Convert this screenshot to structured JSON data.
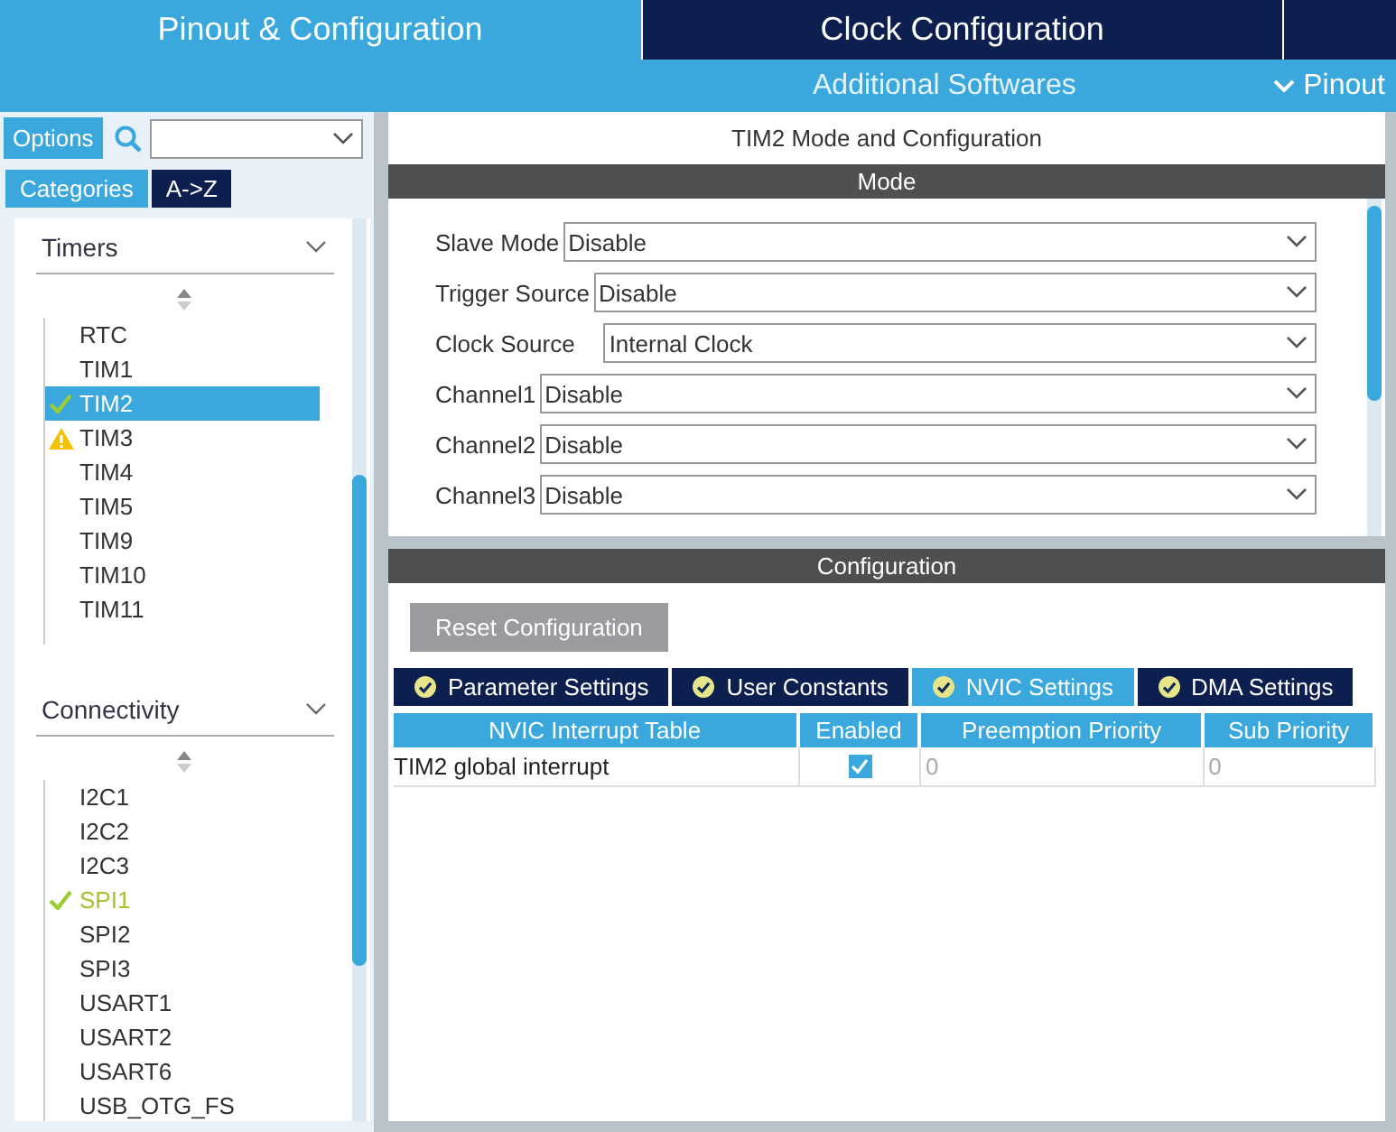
{
  "header_tabs": [
    {
      "label": "Pinout & Configuration",
      "selected": true
    },
    {
      "label": "Clock Configuration",
      "selected": false
    }
  ],
  "subnav": {
    "additional": "Additional Softwares",
    "pinout": "Pinout"
  },
  "sidebar": {
    "options_button": "Options",
    "view_tabs": [
      {
        "label": "Categories",
        "selected": true
      },
      {
        "label": "A->Z",
        "selected": false
      }
    ],
    "categories": [
      {
        "name": "Timers",
        "expanded": true,
        "items": [
          {
            "label": "RTC",
            "configured": false,
            "warning": false,
            "selected": false
          },
          {
            "label": "TIM1",
            "configured": false,
            "warning": false,
            "selected": false
          },
          {
            "label": "TIM2",
            "configured": true,
            "warning": false,
            "selected": true
          },
          {
            "label": "TIM3",
            "configured": false,
            "warning": true,
            "selected": false
          },
          {
            "label": "TIM4",
            "configured": false,
            "warning": false,
            "selected": false
          },
          {
            "label": "TIM5",
            "configured": false,
            "warning": false,
            "selected": false
          },
          {
            "label": "TIM9",
            "configured": false,
            "warning": false,
            "selected": false
          },
          {
            "label": "TIM10",
            "configured": false,
            "warning": false,
            "selected": false
          },
          {
            "label": "TIM11",
            "configured": false,
            "warning": false,
            "selected": false
          }
        ]
      },
      {
        "name": "Connectivity",
        "expanded": true,
        "items": [
          {
            "label": "I2C1",
            "configured": false,
            "warning": false,
            "selected": false
          },
          {
            "label": "I2C2",
            "configured": false,
            "warning": false,
            "selected": false
          },
          {
            "label": "I2C3",
            "configured": false,
            "warning": false,
            "selected": false
          },
          {
            "label": "SPI1",
            "configured": true,
            "warning": false,
            "selected": false
          },
          {
            "label": "SPI2",
            "configured": false,
            "warning": false,
            "selected": false
          },
          {
            "label": "SPI3",
            "configured": false,
            "warning": false,
            "selected": false
          },
          {
            "label": "USART1",
            "configured": false,
            "warning": false,
            "selected": false
          },
          {
            "label": "USART2",
            "configured": false,
            "warning": false,
            "selected": false
          },
          {
            "label": "USART6",
            "configured": false,
            "warning": false,
            "selected": false
          },
          {
            "label": "USB_OTG_FS",
            "configured": false,
            "warning": false,
            "selected": false
          }
        ]
      }
    ]
  },
  "mode_panel": {
    "title": "TIM2 Mode and Configuration",
    "header": "Mode",
    "fields": [
      {
        "label": "Slave Mode",
        "value": "Disable"
      },
      {
        "label": "Trigger Source",
        "value": "Disable"
      },
      {
        "label": "Clock Source",
        "value": "Internal Clock"
      },
      {
        "label": "Channel1",
        "value": "Disable"
      },
      {
        "label": "Channel2",
        "value": "Disable"
      },
      {
        "label": "Channel3",
        "value": "Disable"
      }
    ]
  },
  "config_panel": {
    "header": "Configuration",
    "reset_button": "Reset Configuration",
    "tabs": [
      {
        "label": "Parameter Settings",
        "selected": false
      },
      {
        "label": "User Constants",
        "selected": false
      },
      {
        "label": "NVIC Settings",
        "selected": true
      },
      {
        "label": "DMA Settings",
        "selected": false
      }
    ],
    "table": {
      "columns": [
        "NVIC Interrupt Table",
        "Enabled",
        "Preemption Priority",
        "Sub Priority"
      ],
      "rows": [
        {
          "name": "TIM2 global interrupt",
          "enabled": true,
          "preemption_priority": "0",
          "sub_priority": "0"
        }
      ]
    }
  }
}
